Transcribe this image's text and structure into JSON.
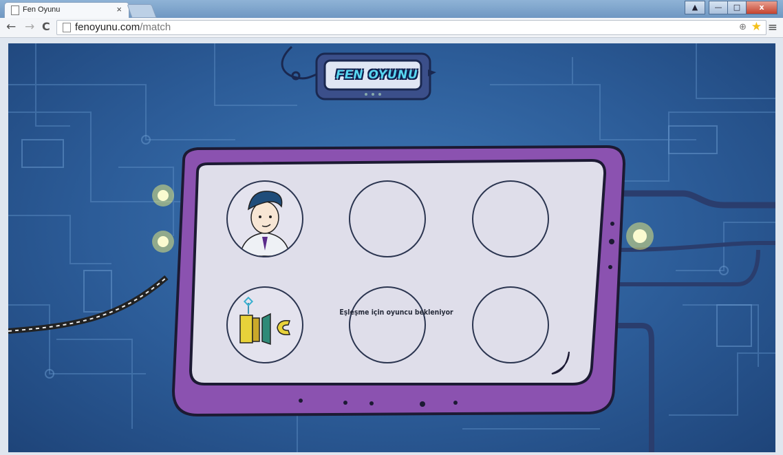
{
  "browser": {
    "tab_title": "Fen Oyunu",
    "tab_close": "×",
    "url_host": "fenoyunu.com",
    "url_path": "/match",
    "back": "←",
    "forward": "→",
    "reload": "C",
    "menu": "≡"
  },
  "window_controls": {
    "user": "▲",
    "minimize": "—",
    "maximize": "□",
    "close": "x"
  },
  "game": {
    "logo": "FEN OYUNU",
    "status": "Eşleşme için oyuncu bekleniyor",
    "slots": [
      {
        "state": "player",
        "avatar": "boy-scientist-avatar"
      },
      {
        "state": "empty"
      },
      {
        "state": "empty"
      },
      {
        "state": "player",
        "avatar": "magnet-robot-avatar"
      },
      {
        "state": "empty"
      },
      {
        "state": "empty"
      }
    ]
  },
  "colors": {
    "background": "#2c5c98",
    "board_frame": "#8b52b0",
    "board_screen": "#dfdeea",
    "accent_glow": "#f2f27a",
    "logo_text": "#58d6f0"
  }
}
